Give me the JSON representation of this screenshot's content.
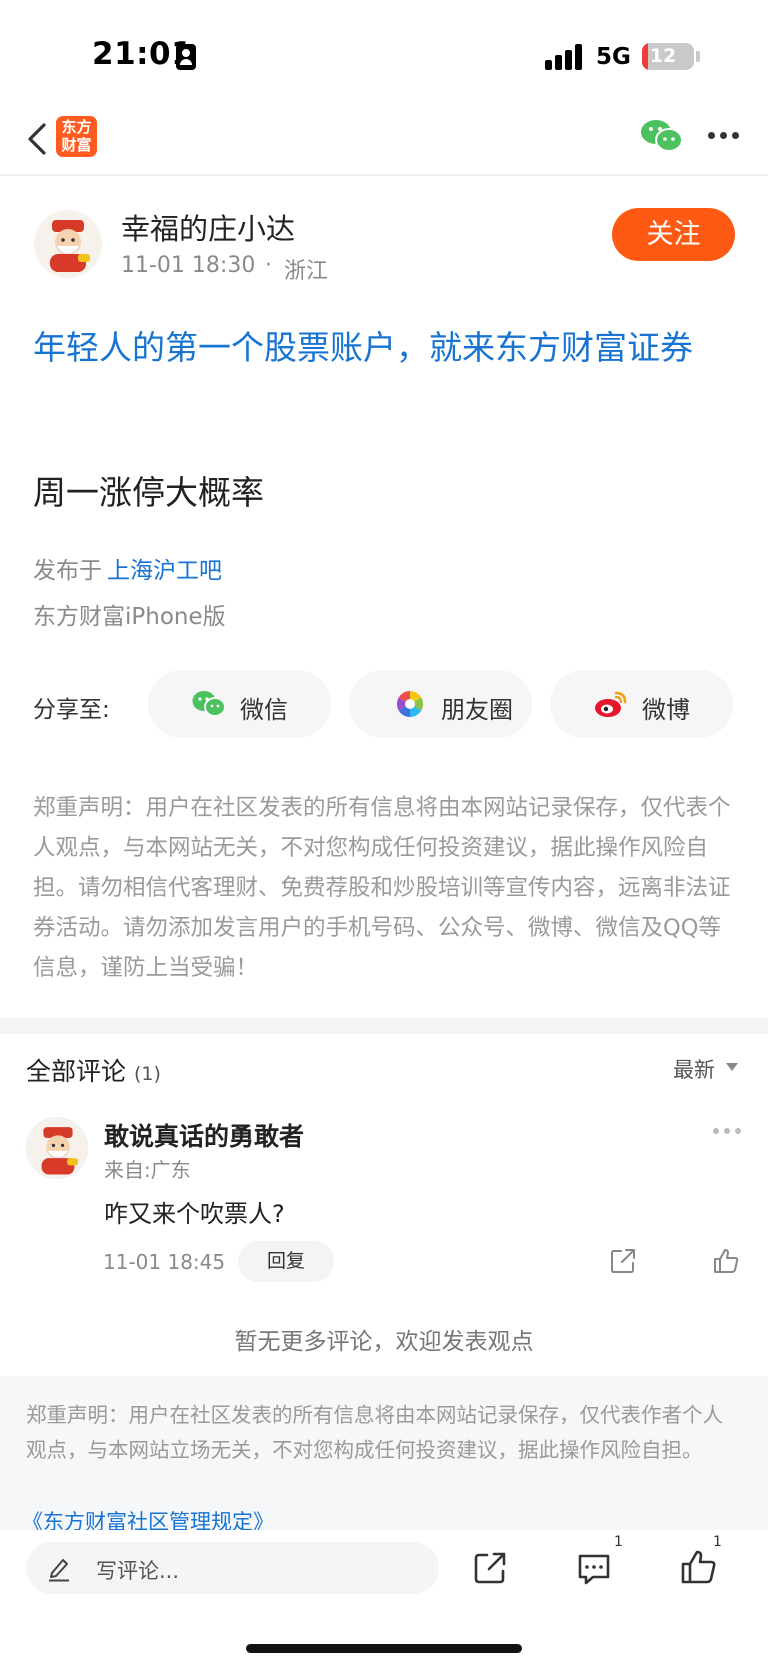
{
  "status_bar": {
    "time": "21:01",
    "network": "5G",
    "battery_level": "12",
    "battery_percent": 12
  },
  "nav": {
    "app_logo_line1": "东方",
    "app_logo_line2": "财富"
  },
  "post": {
    "author_name": "幸福的庄小达",
    "time": "11-01 18:30",
    "separator": "·",
    "location": "浙江",
    "follow_label": "关注",
    "link_title": "年轻人的第一个股票账户，就来东方财富证券",
    "body": "周一涨停大概率",
    "published_prefix": "发布于",
    "published_forum": "上海沪工吧",
    "client": "东方财富iPhone版"
  },
  "share": {
    "label": "分享至:",
    "targets": [
      {
        "label": "微信",
        "icon": "wechat-icon"
      },
      {
        "label": "朋友圈",
        "icon": "moments-icon"
      },
      {
        "label": "微博",
        "icon": "weibo-icon"
      }
    ]
  },
  "disclaimer": "郑重声明：用户在社区发表的所有信息将由本网站记录保存，仅代表个人观点，与本网站无关，不对您构成任何投资建议，据此操作风险自担。请勿相信代客理财、免费荐股和炒股培训等宣传内容，远离非法证券活动。请勿添加发言用户的手机号码、公众号、微博、微信及QQ等信息，谨防上当受骗！",
  "comments": {
    "header": "全部评论",
    "count": "(1)",
    "sort": "最新",
    "items": [
      {
        "name": "敢说真话的勇敢者",
        "source": "来自:广东",
        "text": "咋又来个吹票人?",
        "time": "11-01 18:45",
        "reply_label": "回复"
      }
    ],
    "no_more": "暂无更多评论，欢迎发表观点"
  },
  "footer": {
    "disclaimer": "郑重声明：用户在社区发表的所有信息将由本网站记录保存，仅代表作者个人观点，与本网站立场无关，不对您构成任何投资建议，据此操作风险自担。",
    "rules_link": "《东方财富社区管理规定》"
  },
  "bottom_bar": {
    "input_placeholder": "写评论...",
    "comment_count": "1",
    "like_count": "1"
  },
  "colors": {
    "accent": "#ff5a14",
    "link": "#1874d2",
    "wechat": "#4cc25f"
  }
}
